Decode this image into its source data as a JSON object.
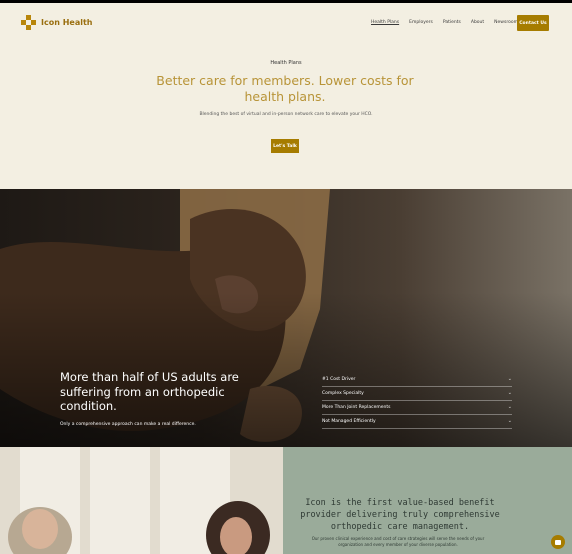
{
  "brand": {
    "name": "Icon Health"
  },
  "nav": {
    "items": [
      "Health Plans",
      "Employers",
      "Patients",
      "About",
      "Newsroom"
    ],
    "contact_label": "Contact Us"
  },
  "hero": {
    "eyebrow": "Health Plans",
    "title": "Better care for members. Lower costs for health plans.",
    "subtitle": "Blending the best of virtual and in-person network care to elevate your HCO.",
    "cta_label": "Let's Talk"
  },
  "feature": {
    "headline": "More than half of US adults are suffering from an orthopedic condition.",
    "caption": "Only a comprehensive approach can make a real difference.",
    "accordion": [
      "#1 Cost Driver",
      "Complex Specialty",
      "More Than Joint Replacements",
      "Not Managed Efficiently"
    ]
  },
  "value": {
    "title": "Icon is the first value-based benefit provider delivering truly comprehensive orthopedic care management.",
    "subtitle": "Our proven clinical experience and cost of care strategies will serve the needs of your organization and every member of your diverse population."
  },
  "colors": {
    "accent": "#a67c00",
    "hero_title": "#b89438",
    "sage": "#9aab9a",
    "cream": "#f3efe2"
  },
  "icons": {
    "chat": "chat-icon",
    "chevron": "chevron-down-icon"
  }
}
